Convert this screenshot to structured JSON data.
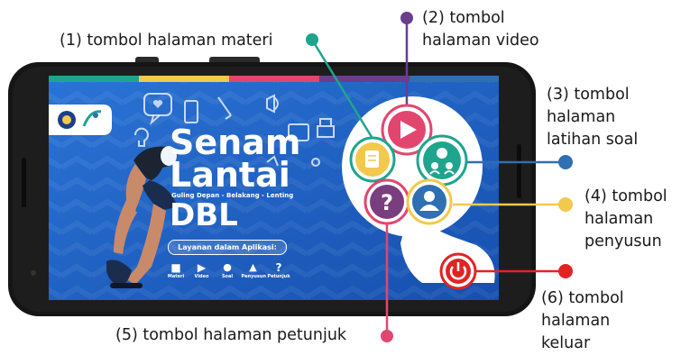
{
  "callouts": {
    "c1": "(1) tombol halaman materi",
    "c2": "(2) tombol\nhalaman video",
    "c3": "(3) tombol\nhalaman\nlatihan soal",
    "c4": "(4) tombol\nhalaman\npenyusun",
    "c5": "(5) tombol halaman petunjuk",
    "c6": "(6) tombol\nhalaman\nkeluar"
  },
  "app": {
    "title_line1": "Senam",
    "title_line2": "Lantai",
    "subtitle": "Guling Depan - Belakang - Lenting",
    "title_line3": "DBL",
    "services_heading": "Layanan dalam Aplikasi:",
    "services": [
      {
        "label": "Materi",
        "icon": "book-icon"
      },
      {
        "label": "Video",
        "icon": "play-icon"
      },
      {
        "label": "Soal",
        "icon": "group-icon"
      },
      {
        "label": "Penyusun",
        "icon": "user-icon"
      },
      {
        "label": "Petunjuk",
        "icon": "question-icon"
      }
    ],
    "menu_buttons": [
      {
        "name": "materi",
        "icon": "book-icon"
      },
      {
        "name": "video",
        "icon": "play-icon"
      },
      {
        "name": "latihan-soal",
        "icon": "quiz-icon"
      },
      {
        "name": "penyusun",
        "icon": "user-icon"
      },
      {
        "name": "petunjuk",
        "icon": "question-icon"
      },
      {
        "name": "keluar",
        "icon": "power-icon"
      }
    ]
  },
  "colors": {
    "teal": "#1fa58d",
    "purple": "#6a3d8f",
    "blue": "#2f6fb3",
    "yellow": "#f2c94c",
    "pink": "#e2466f",
    "red": "#e02424",
    "screen_bg": "#1e5fc2"
  }
}
